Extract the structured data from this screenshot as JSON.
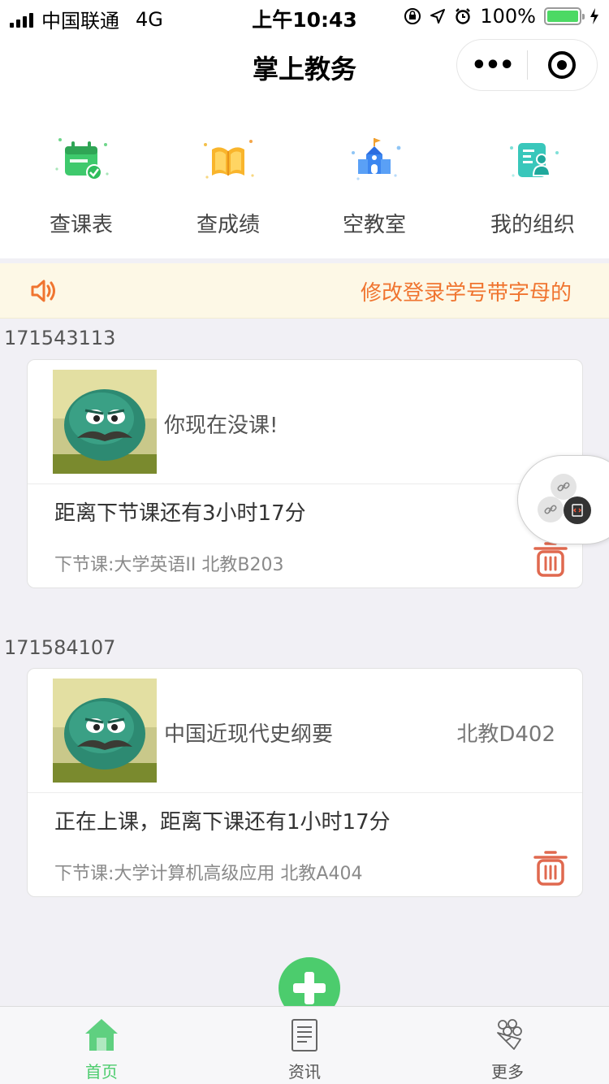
{
  "status": {
    "carrier": "中国联通",
    "network": "4G",
    "time": "上午10:43",
    "battery": "100%"
  },
  "nav": {
    "title": "掌上教务"
  },
  "grid": [
    {
      "label": "查课表",
      "icon": "calendar-check-icon"
    },
    {
      "label": "查成绩",
      "icon": "open-book-icon"
    },
    {
      "label": "空教室",
      "icon": "school-building-icon"
    },
    {
      "label": "我的组织",
      "icon": "member-card-icon"
    }
  ],
  "notice": {
    "text": "修改登录学号带字母的"
  },
  "cards": [
    {
      "id": "171543113",
      "message": "你现在没课!",
      "room": "",
      "status": "距离下节课还有3小时17分",
      "next": "下节课:大学英语II 北教B203"
    },
    {
      "id": "171584107",
      "message": "中国近现代史纲要",
      "room": "北教D402",
      "status": "正在上课，距离下课还有1小时17分",
      "next": "下节课:大学计算机高级应用 北教A404"
    }
  ],
  "tabs": [
    {
      "label": "首页",
      "icon": "home-icon",
      "active": true
    },
    {
      "label": "资讯",
      "icon": "news-icon",
      "active": false
    },
    {
      "label": "更多",
      "icon": "bouquet-icon",
      "active": false
    }
  ],
  "colors": {
    "accent": "#4ccc6d",
    "notice": "#f07530",
    "trash": "#e0694f"
  }
}
